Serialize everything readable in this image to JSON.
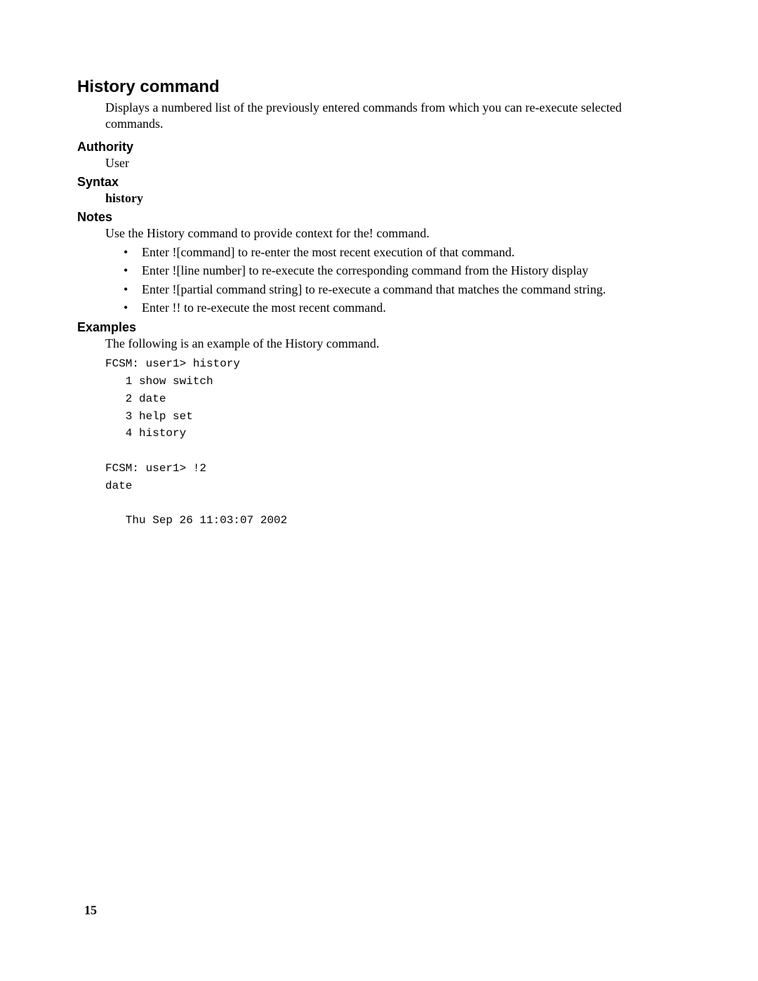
{
  "title": "History command",
  "lead": "Displays a numbered list of the previously entered commands from which you can re-execute selected commands.",
  "authority": {
    "heading": "Authority",
    "value": "User"
  },
  "syntax": {
    "heading": "Syntax",
    "value": "history"
  },
  "notes": {
    "heading": "Notes",
    "intro": "Use the History command to provide context for the! command.",
    "items": [
      "Enter ![command] to re-enter the most recent execution of that command.",
      "Enter ![line number] to re-execute the corresponding command from the History display",
      "Enter ![partial command string] to re-execute a command that matches the command string.",
      "Enter !! to re-execute the most recent command."
    ]
  },
  "examples": {
    "heading": "Examples",
    "intro": "The following is an example of the History command.",
    "console": "FCSM: user1> history\n   1 show switch\n   2 date\n   3 help set\n   4 history\n\nFCSM: user1> !2\ndate\n\n   Thu Sep 26 11:03:07 2002"
  },
  "page_number": "15"
}
